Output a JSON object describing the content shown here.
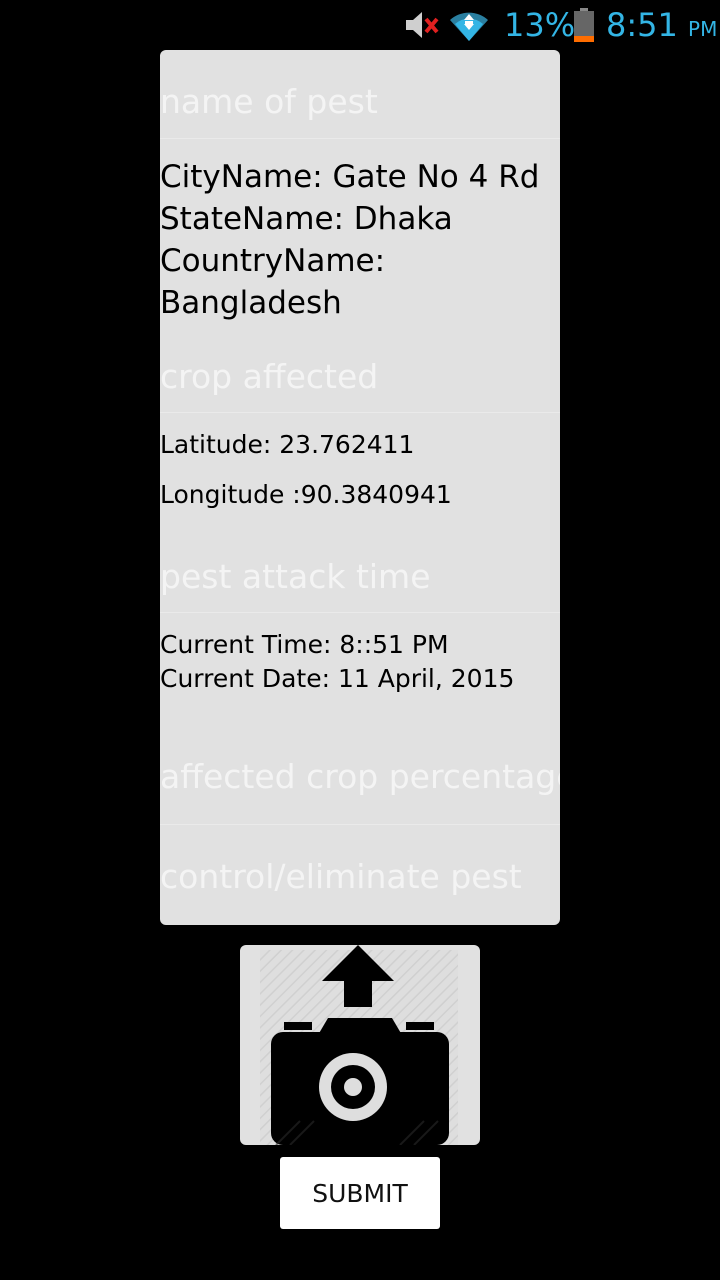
{
  "status_bar": {
    "battery_percent": "13%",
    "time": "8:51",
    "ampm": "PM",
    "icons": [
      "mute-icon",
      "wifi-icon",
      "battery-icon"
    ],
    "accent_color": "#33b5e5"
  },
  "form": {
    "pest_name_placeholder": "name of pest",
    "location": {
      "city": "CityName: Gate No 4 Rd",
      "state": "StateName: Dhaka",
      "country_label": "CountryName:",
      "country_value": "Bangladesh"
    },
    "crop_affected_placeholder": "crop affected",
    "latitude": "Latitude: 23.762411",
    "longitude": "Longitude :90.3840941",
    "pest_attack_time_placeholder": "pest attack time",
    "current_time": "Current Time: 8::51 PM",
    "current_date": "Current Date: 11 April, 2015",
    "affected_crop_percentage_placeholder": "affected crop percentage",
    "control_pest_placeholder": "control/eliminate pest"
  },
  "actions": {
    "camera_icon": "camera-upload-icon",
    "submit_label": "SUBMIT"
  }
}
